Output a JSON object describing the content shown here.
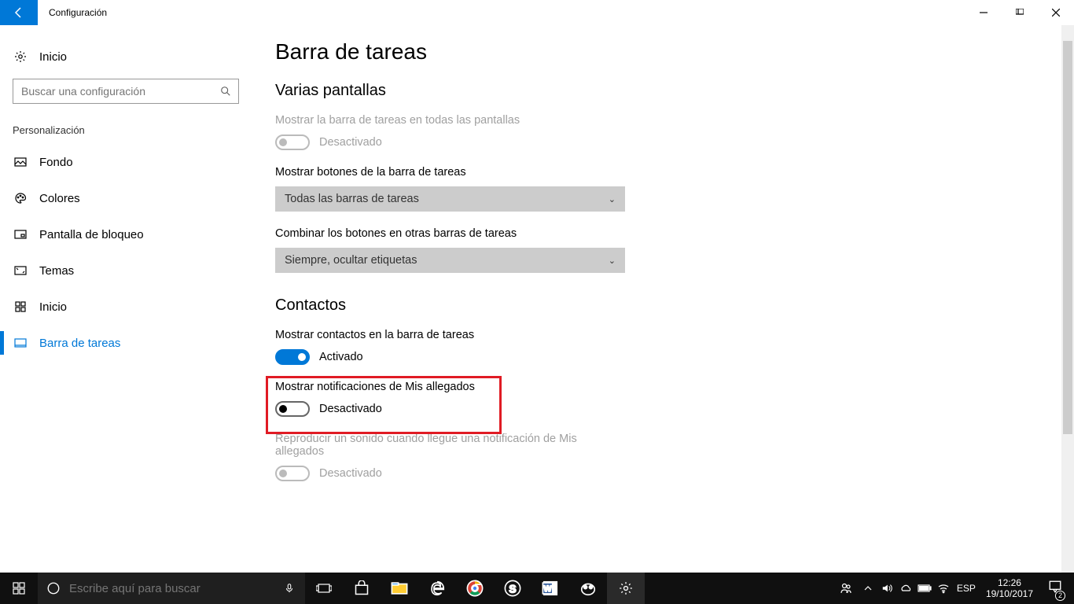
{
  "titlebar": {
    "app_name": "Configuración"
  },
  "sidebar": {
    "home": "Inicio",
    "search_placeholder": "Buscar una configuración",
    "section": "Personalización",
    "items": [
      {
        "label": "Fondo"
      },
      {
        "label": "Colores"
      },
      {
        "label": "Pantalla de bloqueo"
      },
      {
        "label": "Temas"
      },
      {
        "label": "Inicio"
      },
      {
        "label": "Barra de tareas"
      }
    ]
  },
  "content": {
    "heading": "Barra de tareas",
    "section1": {
      "title": "Varias pantallas",
      "opt1_label": "Mostrar la barra de tareas en todas las pantallas",
      "opt1_state": "Desactivado",
      "opt2_label": "Mostrar botones de la barra de tareas",
      "opt2_value": "Todas las barras de tareas",
      "opt3_label": "Combinar los botones en otras barras de tareas",
      "opt3_value": "Siempre, ocultar etiquetas"
    },
    "section2": {
      "title": "Contactos",
      "opt1_label": "Mostrar contactos en la barra de tareas",
      "opt1_state": "Activado",
      "opt2_label": "Mostrar notificaciones de Mis allegados",
      "opt2_state": "Desactivado",
      "opt3_label": "Reproducir un sonido cuando llegue una notificación de Mis allegados",
      "opt3_state": "Desactivado"
    }
  },
  "taskbar": {
    "search_placeholder": "Escribe aquí para buscar",
    "lang": "ESP",
    "time": "12:26",
    "date": "19/10/2017",
    "notif_count": "2"
  }
}
